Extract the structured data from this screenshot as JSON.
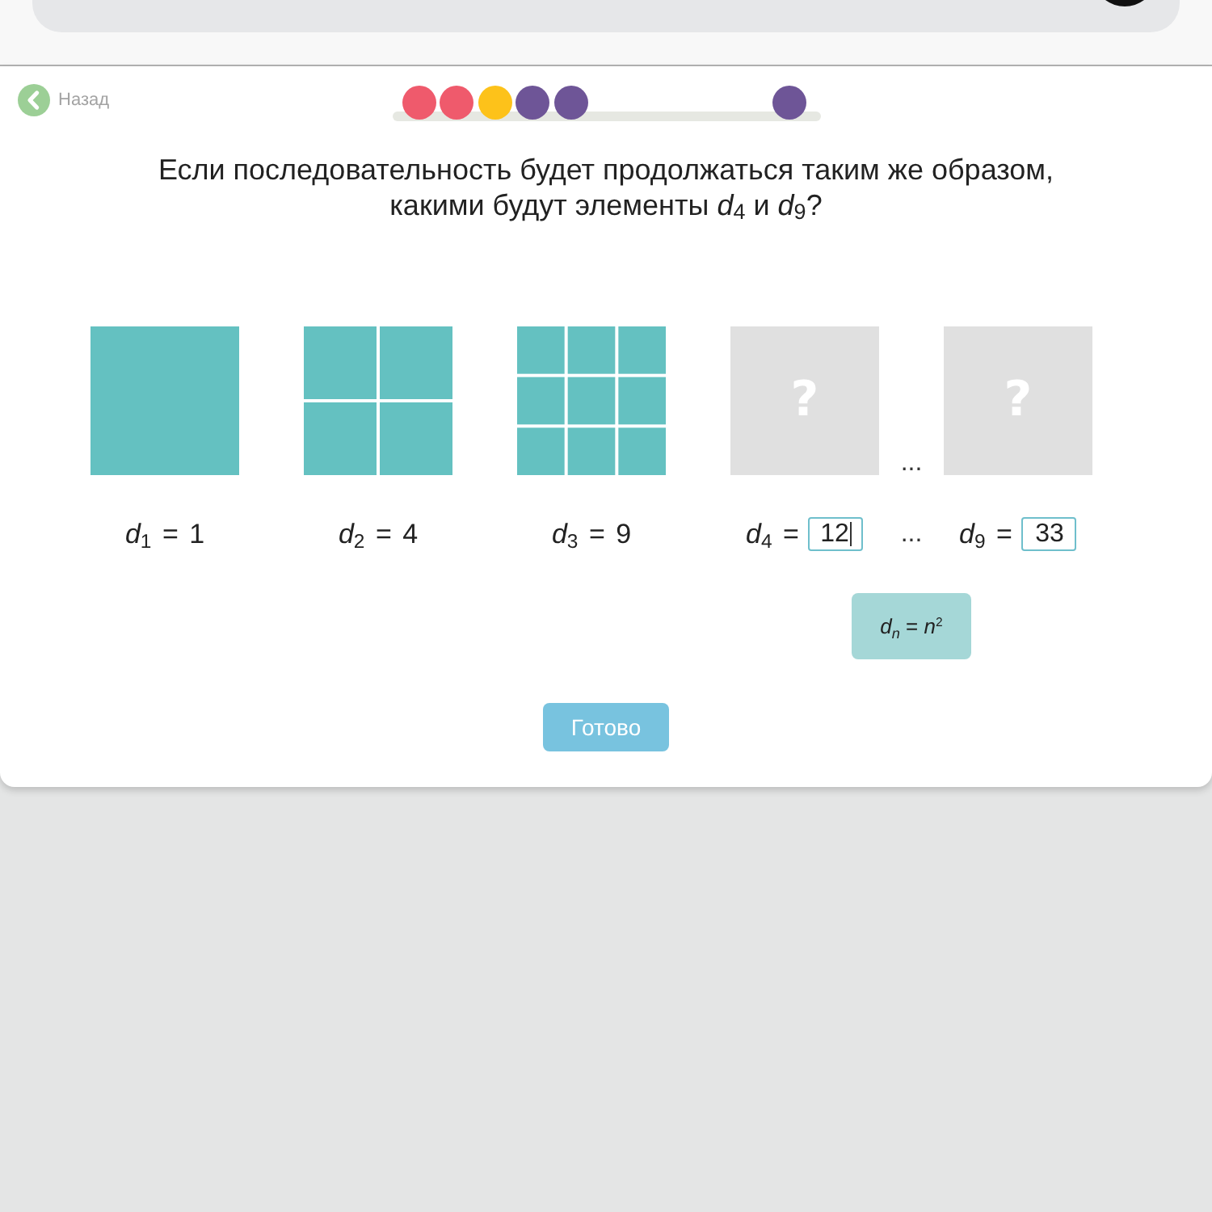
{
  "header": {
    "back_label": "Назад"
  },
  "progress": {
    "dots": [
      {
        "color": "#ef5a6c"
      },
      {
        "color": "#ef5a6c"
      },
      {
        "color": "#fdc21a"
      },
      {
        "color": "#6e5597"
      },
      {
        "color": "#6e5597"
      }
    ],
    "current": {
      "color": "#6e5597"
    }
  },
  "question": "Если последовательность будет продолжаться таким же образом, какими будут элементы *d*$_{4}$ и *d*$_{9}$?",
  "figures": [
    {
      "kind": "grid",
      "rows": [
        [
          {
            "filled": true
          }
        ]
      ],
      "label": "*d*$_{1}$ = 1"
    },
    {
      "kind": "grid",
      "rows": [
        [
          {
            "filled": true
          },
          {
            "filled": true
          }
        ],
        [
          {
            "filled": true
          },
          {
            "filled": true
          }
        ]
      ],
      "label": "*d*$_{2}$ = 4"
    },
    {
      "kind": "grid",
      "rows": [
        [
          {
            "filled": true
          },
          {
            "filled": true
          },
          {
            "filled": true
          }
        ],
        [
          {
            "filled": true
          },
          {
            "filled": true
          },
          {
            "filled": true
          }
        ],
        [
          {
            "filled": true
          },
          {
            "filled": true
          },
          {
            "filled": true
          }
        ]
      ],
      "label": "*d*$_{3}$ = 9"
    },
    {
      "kind": "unknown",
      "symbol": "?",
      "label": "*d*$_{4}$ =",
      "answer": {
        "value": "12",
        "focused": true
      }
    },
    {
      "kind": "ellipsis",
      "top": "...",
      "bottom": "..."
    },
    {
      "kind": "unknown",
      "symbol": "?",
      "label": "*d*$_{9}$ =",
      "answer": {
        "value": "33",
        "focused": false
      }
    }
  ],
  "hint": {
    "formula": "*d*$_{n}$ = *n*$^{2}$"
  },
  "button": {
    "label": "Готово"
  }
}
